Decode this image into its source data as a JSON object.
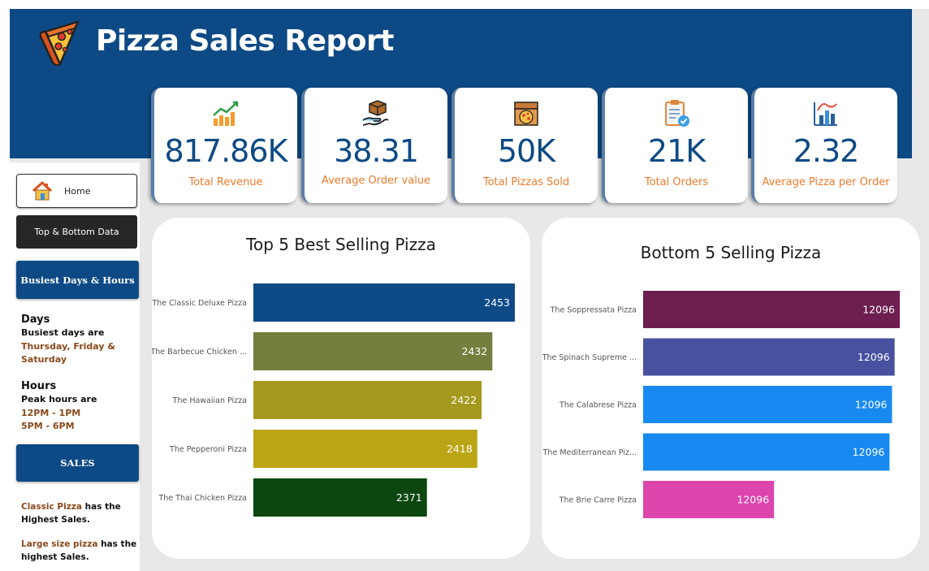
{
  "header": {
    "title": "Pizza Sales Report",
    "logo_icon": "pizza-slice-icon",
    "band_color": "#0d4a85"
  },
  "kpis": [
    {
      "value": "817.86K",
      "label": "Total Revenue",
      "icon": "revenue-growth-icon"
    },
    {
      "value": "38.31",
      "label": "Average Order value",
      "icon": "delivery-box-icon"
    },
    {
      "value": "50K",
      "label": "Total Pizzas Sold",
      "icon": "pizza-box-icon"
    },
    {
      "value": "21K",
      "label": "Total Orders",
      "icon": "order-clipboard-icon"
    },
    {
      "value": "2.32",
      "label": "Average Pizza per Order",
      "icon": "bar-chart-icon"
    }
  ],
  "nav": {
    "home": "Home",
    "top_bottom": "Top & Bottom Data",
    "busiest": "Busiest Days & Hours",
    "sales": "SALES"
  },
  "insights": {
    "days_heading": "Days",
    "days_line": "Busiest days are",
    "days_value": "Thursday, Friday & Saturday",
    "hours_heading": "Hours",
    "hours_line": "Peak hours are",
    "hours_value_1": "12PM - 1PM",
    "hours_value_2": "5PM - 6PM",
    "sales_1_accent": "Classic Pizza",
    "sales_1_rest": " has the",
    "sales_1_line2": "Highest Sales.",
    "sales_2_accent": "Large size pizza",
    "sales_2_rest": " has the",
    "sales_2_line2": "highest Sales."
  },
  "chart_data": [
    {
      "type": "bar",
      "orientation": "horizontal",
      "title": "Top 5 Best Selling Pizza",
      "categories": [
        "The Classic Deluxe Pizza",
        "The Barbecue Chicken ...",
        "The Hawaiian Pizza",
        "The Pepperoni Pizza",
        "The Thai Chicken Pizza"
      ],
      "values": [
        2453,
        2432,
        2422,
        2418,
        2371
      ],
      "colors": [
        "#0e4a86",
        "#747f3d",
        "#a59a1f",
        "#bba515",
        "#0c470f"
      ],
      "data_labels": true,
      "grid": false
    },
    {
      "type": "bar",
      "orientation": "horizontal",
      "title": "Bottom 5 Selling Pizza",
      "categories": [
        "The Soppressata Pizza",
        "The Spinach Supreme ...",
        "The Calabrese Pizza",
        "The Mediterranean Piz...",
        "The Brie Carre Pizza"
      ],
      "values": [
        12096,
        12096,
        12096,
        12096,
        12096
      ],
      "relative_fill": [
        1.0,
        0.98,
        0.97,
        0.96,
        0.51
      ],
      "colors": [
        "#6d1e50",
        "#4850a0",
        "#1889f0",
        "#1889f0",
        "#dd45ad"
      ],
      "data_labels": true,
      "grid": false
    }
  ]
}
